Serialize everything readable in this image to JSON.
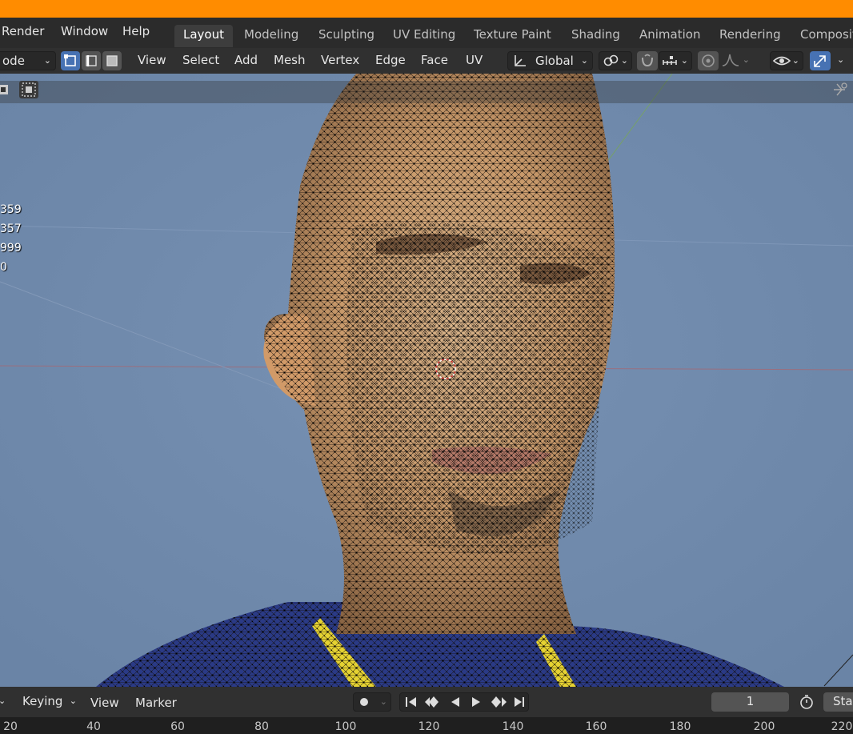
{
  "menu": {
    "items": [
      "Render",
      "Window",
      "Help"
    ]
  },
  "workspaces": {
    "tabs": [
      "Layout",
      "Modeling",
      "Sculpting",
      "UV Editing",
      "Texture Paint",
      "Shading",
      "Animation",
      "Rendering",
      "Composit"
    ],
    "active": "Layout"
  },
  "viewport_header": {
    "mode_label": "ode",
    "menus": [
      "View",
      "Select",
      "Add",
      "Mesh",
      "Vertex",
      "Edge",
      "Face",
      "UV"
    ],
    "transform_orientation": "Global"
  },
  "stats": {
    "lines": [
      "359",
      "357",
      "999",
      "0"
    ]
  },
  "timeline": {
    "menus": [
      "Keying",
      "View",
      "Marker"
    ],
    "current_frame": "1",
    "start_label": "Sta"
  },
  "ruler": {
    "labels": [
      "20",
      "40",
      "60",
      "80",
      "100",
      "120",
      "140",
      "160",
      "180",
      "200",
      "220"
    ]
  },
  "colors": {
    "accent_orange": "#ff8c00",
    "active_blue": "#4772b3",
    "viewport_bg": "#6f8aad"
  }
}
